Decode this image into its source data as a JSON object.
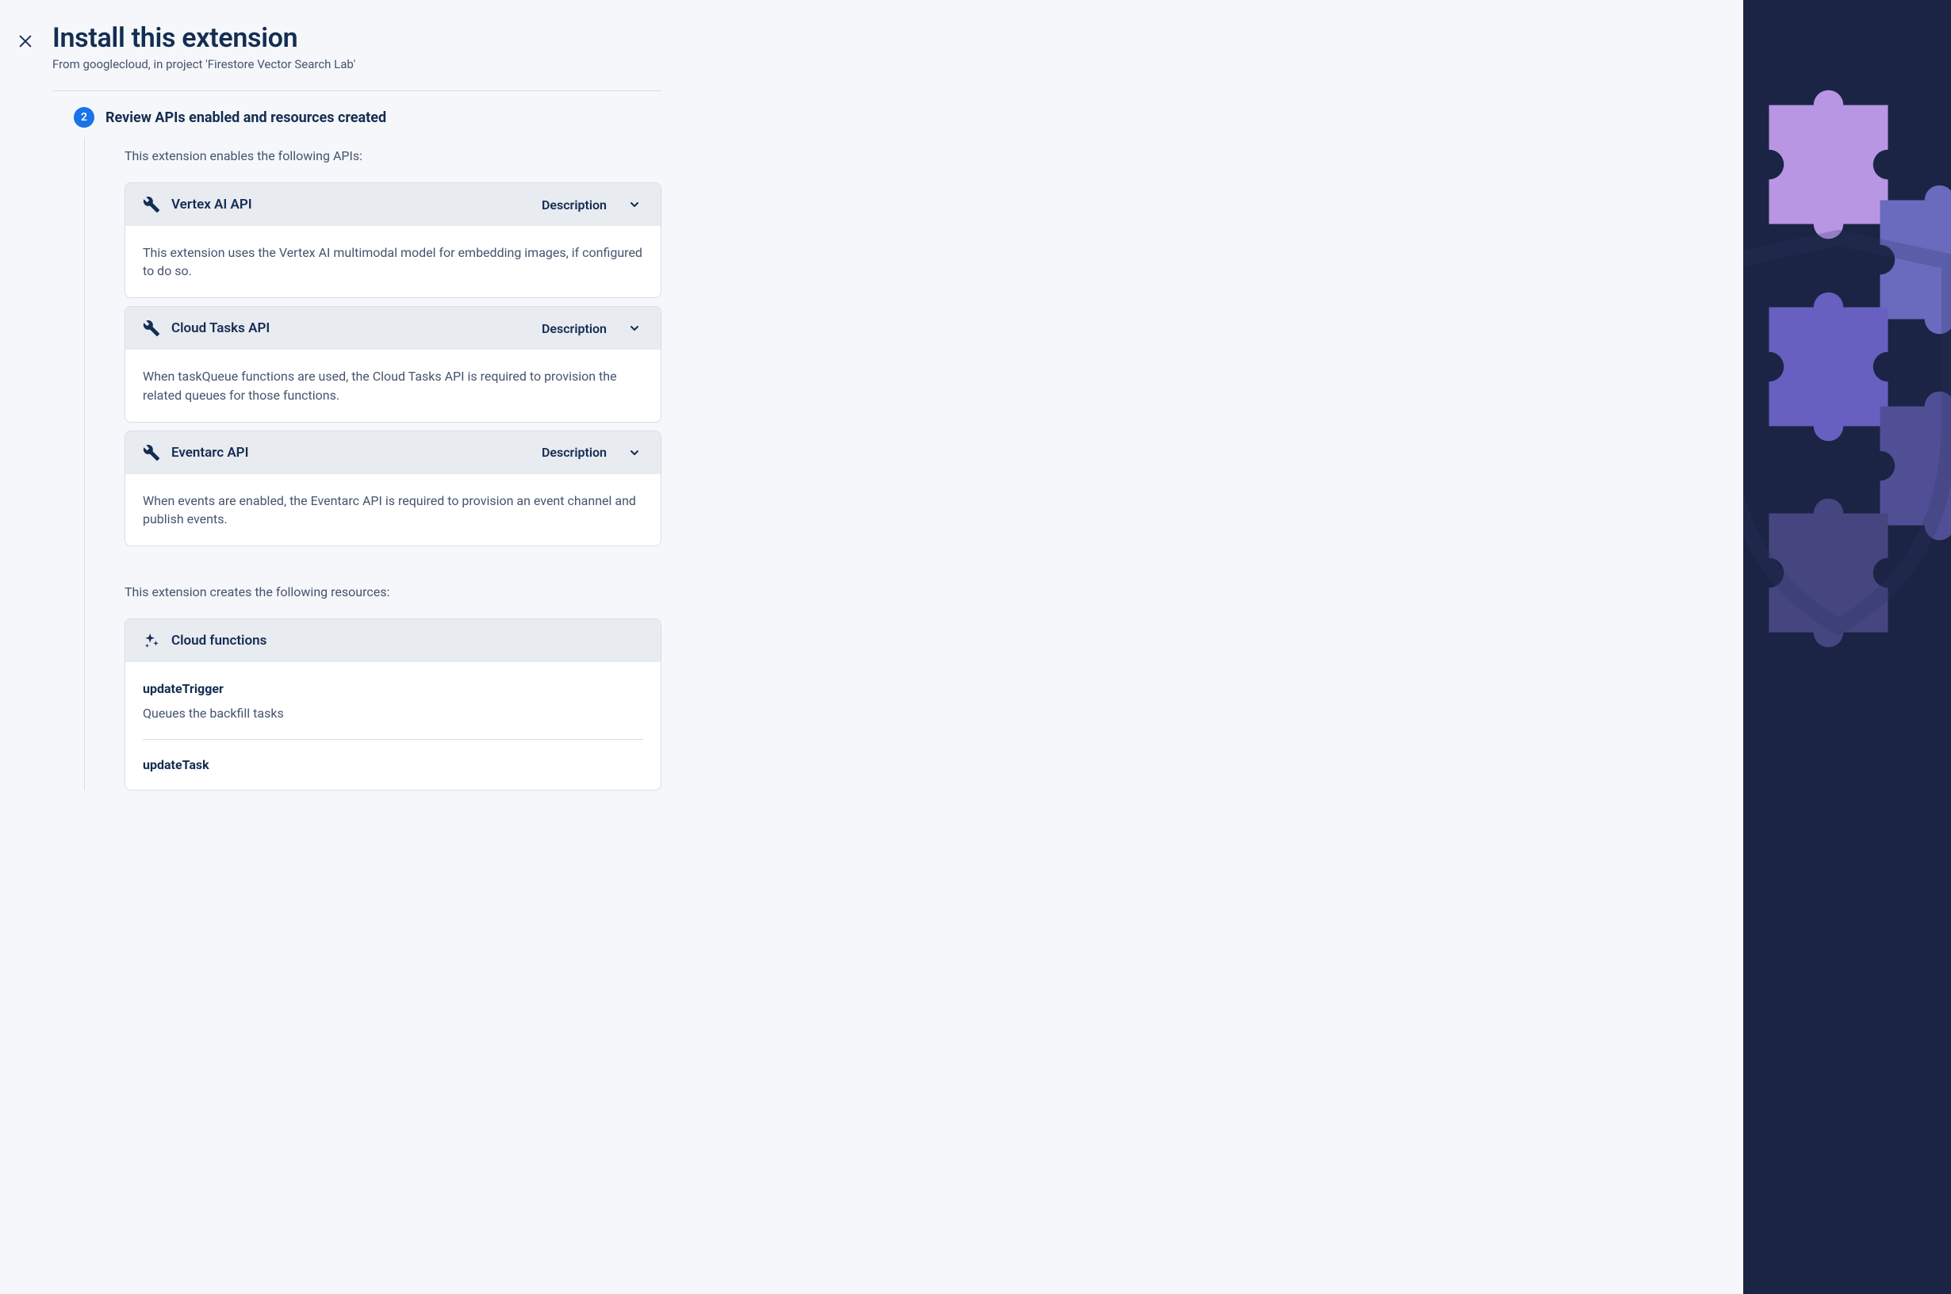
{
  "header": {
    "title": "Install this extension",
    "subtitle": "From googlecloud, in project 'Firestore Vector Search Lab'"
  },
  "step": {
    "number": "2",
    "title": "Review APIs enabled and resources created"
  },
  "apis_intro": "This extension enables the following APIs:",
  "description_label": "Description",
  "apis": [
    {
      "name": "Vertex AI API",
      "description": "This extension uses the Vertex AI multimodal model for embedding images, if configured to do so."
    },
    {
      "name": "Cloud Tasks API",
      "description": "When taskQueue functions are used, the Cloud Tasks API is required to provision the related queues for those functions."
    },
    {
      "name": "Eventarc API",
      "description": "When events are enabled, the Eventarc API is required to provision an event channel and publish events."
    }
  ],
  "resources_intro": "This extension creates the following resources:",
  "resources_card_title": "Cloud functions",
  "functions": [
    {
      "name": "updateTrigger",
      "description": "Queues the backfill tasks"
    },
    {
      "name": "updateTask",
      "description": ""
    }
  ]
}
